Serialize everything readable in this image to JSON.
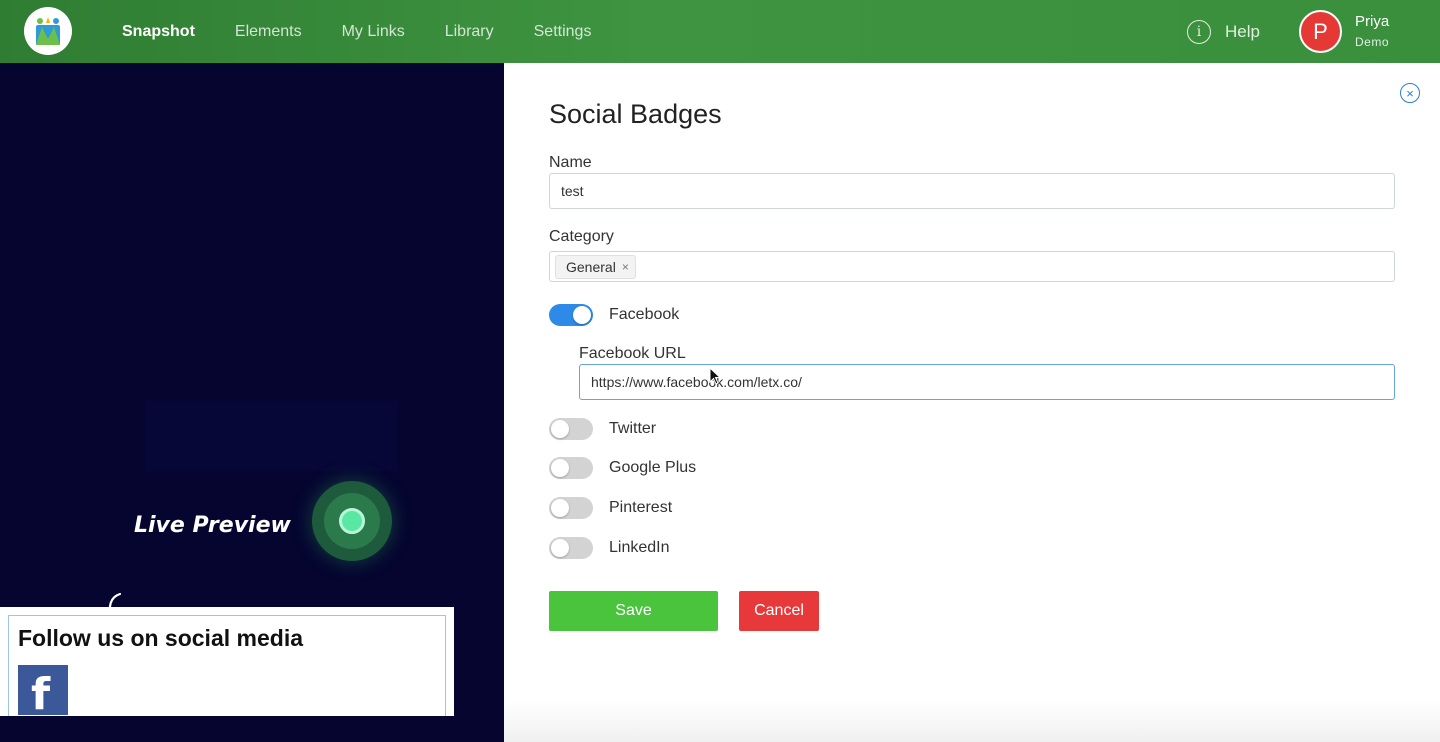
{
  "nav": {
    "items": [
      "Snapshot",
      "Elements",
      "My Links",
      "Library",
      "Settings"
    ],
    "active": "Snapshot",
    "help_label": "Help",
    "user_initial": "P",
    "user_name": "Priya",
    "user_role": "Demo"
  },
  "background": {
    "live_preview_label": "Live Preview",
    "preview_title": "Follow us on social media",
    "preview_badge_letter": "f"
  },
  "form": {
    "title": "Social Badges",
    "name_label": "Name",
    "name_value": "test",
    "category_label": "Category",
    "category_tags": [
      "General"
    ],
    "tag_remove": "×",
    "close_glyph": "×",
    "toggles": [
      {
        "label": "Facebook",
        "on": true
      },
      {
        "label": "Twitter",
        "on": false
      },
      {
        "label": "Google Plus",
        "on": false
      },
      {
        "label": "Pinterest",
        "on": false
      },
      {
        "label": "LinkedIn",
        "on": false
      }
    ],
    "facebook_url_label": "Facebook URL",
    "facebook_url_value": "https://www.facebook.com/letx.co/",
    "save_label": "Save",
    "cancel_label": "Cancel"
  },
  "colors": {
    "nav_green": "#3a8f3c",
    "toggle_on": "#2d8ae6",
    "save": "#4ac43c",
    "cancel": "#e8393a",
    "avatar": "#e53935",
    "facebook": "#3b5998"
  },
  "icons": {
    "logo": "app-logo-icon",
    "help": "info-circle-icon",
    "close": "close-circle-icon",
    "arrow": "curved-arrow-down-icon",
    "pulse": "live-pulse-icon"
  }
}
